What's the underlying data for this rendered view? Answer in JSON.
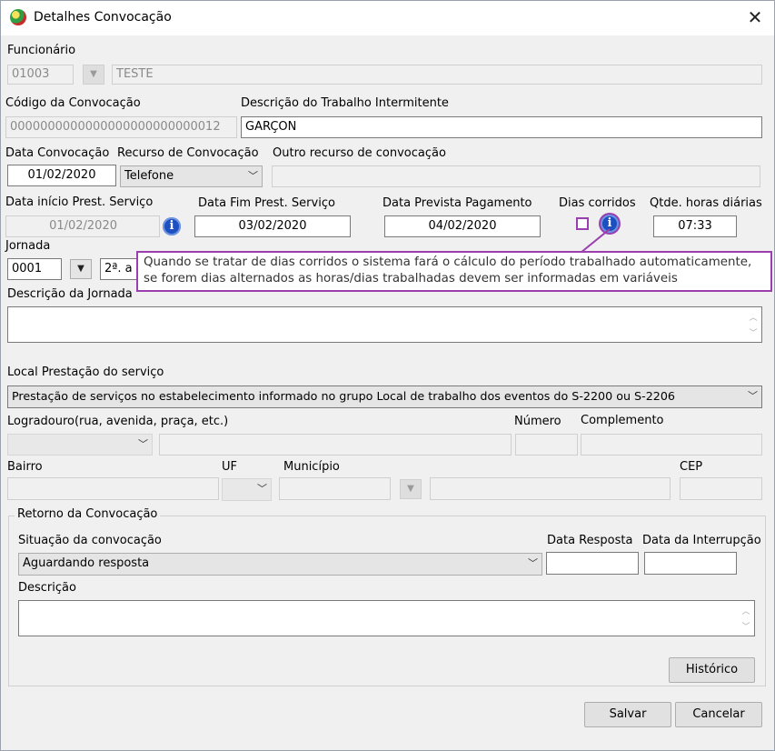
{
  "window": {
    "title": "Detalhes Convocação"
  },
  "funcionario": {
    "label": "Funcionário",
    "code": "01003",
    "name": "TESTE"
  },
  "codigo": {
    "label": "Código da Convocação",
    "value": "0000000000000000000000000012"
  },
  "descricao_trabalho": {
    "label": "Descrição do Trabalho Intermitente",
    "value": "GARÇON"
  },
  "data_convocacao": {
    "label": "Data Convocação",
    "value": "01/02/2020"
  },
  "recurso": {
    "label": "Recurso de Convocação",
    "value": "Telefone"
  },
  "outro_recurso": {
    "label": "Outro recurso de convocação",
    "value": ""
  },
  "data_inicio": {
    "label": "Data início Prest. Serviço",
    "value": "01/02/2020"
  },
  "data_fim": {
    "label": "Data Fim Prest. Serviço",
    "value": "03/02/2020"
  },
  "data_pagamento": {
    "label": "Data Prevista Pagamento",
    "value": "04/02/2020"
  },
  "dias_corridos": {
    "label": "Dias corridos",
    "checked": false
  },
  "qtde_horas": {
    "label": "Qtde. horas diárias",
    "value": "07:33"
  },
  "tooltip": {
    "line1": "Quando se tratar de dias corridos o sistema fará o cálculo do período trabalhado automaticamente,",
    "line2": "se forem dias alternados as horas/dias trabalhadas devem ser informadas em variáveis"
  },
  "jornada": {
    "label": "Jornada",
    "code": "0001",
    "desc": "2ª. a"
  },
  "descricao_jornada": {
    "label": "Descrição da Jornada",
    "value": ""
  },
  "local": {
    "label": "Local Prestação do serviço",
    "value": "Prestação de serviços no estabelecimento informado no grupo Local de trabalho dos eventos do S-2200 ou S-2206"
  },
  "endereco": {
    "logradouro_label": "Logradouro(rua, avenida, praça, etc.)",
    "numero_label": "Número",
    "complemento_label": "Complemento",
    "bairro_label": "Bairro",
    "uf_label": "UF",
    "municipio_label": "Município",
    "cep_label": "CEP"
  },
  "retorno": {
    "group_label": "Retorno da Convocação",
    "situacao_label": "Situação da convocação",
    "situacao_value": "Aguardando resposta",
    "data_resposta_label": "Data Resposta",
    "data_interrupcao_label": "Data da Interrupção",
    "descricao_label": "Descrição",
    "historico_label": "Histórico"
  },
  "buttons": {
    "salvar": "Salvar",
    "cancelar": "Cancelar"
  },
  "colors": {
    "highlight": "#9b3fb0",
    "info": "#1c4fbf"
  },
  "icons": {
    "close": "close-icon",
    "info": "info-icon",
    "dropdown": "chevron-down-icon"
  }
}
